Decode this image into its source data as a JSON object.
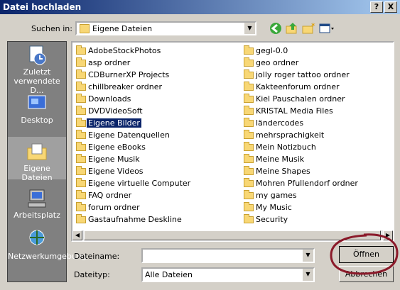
{
  "window": {
    "title": "Datei hochladen",
    "help_label": "?",
    "close_label": "X"
  },
  "lookin": {
    "label": "Suchen in:",
    "value": "Eigene Dateien"
  },
  "places": [
    {
      "label": "Zuletzt verwendete D..."
    },
    {
      "label": "Desktop"
    },
    {
      "label": "Eigene Dateien"
    },
    {
      "label": "Arbeitsplatz"
    },
    {
      "label": "Netzwerkumgebung"
    }
  ],
  "files_left": [
    "AdobeStockPhotos",
    "asp ordner",
    "CDBurnerXP Projects",
    "chillbreaker ordner",
    "Downloads",
    "DVDVideoSoft",
    "Eigene Bilder",
    "Eigene Datenquellen",
    "Eigene eBooks",
    "Eigene Musik",
    "Eigene Videos",
    "Eigene virtuelle Computer",
    "FAQ ordner",
    "forum ordner",
    "Gastaufnahme Deskline"
  ],
  "files_right": [
    "gegl-0.0",
    "geo ordner",
    "jolly roger tattoo ordner",
    "Kakteenforum ordner",
    "Kiel Pauschalen ordner",
    "KRISTAL Media Files",
    "ländercodes",
    "mehrsprachigkeit",
    "Mein Notizbuch",
    "Meine Musik",
    "Meine Shapes",
    "Mohren Pfullendorf ordner",
    "my games",
    "My Music",
    "Security"
  ],
  "selected_file": "Eigene Bilder",
  "filename": {
    "label": "Dateiname:",
    "value": ""
  },
  "filetype": {
    "label": "Dateityp:",
    "value": "Alle Dateien"
  },
  "buttons": {
    "open": "Öffnen",
    "cancel": "Abbrechen"
  },
  "colors": {
    "titlebar": "#0a246a",
    "selection": "#0a246a",
    "folder": "#f8d775",
    "circle": "#8b1a2a"
  }
}
